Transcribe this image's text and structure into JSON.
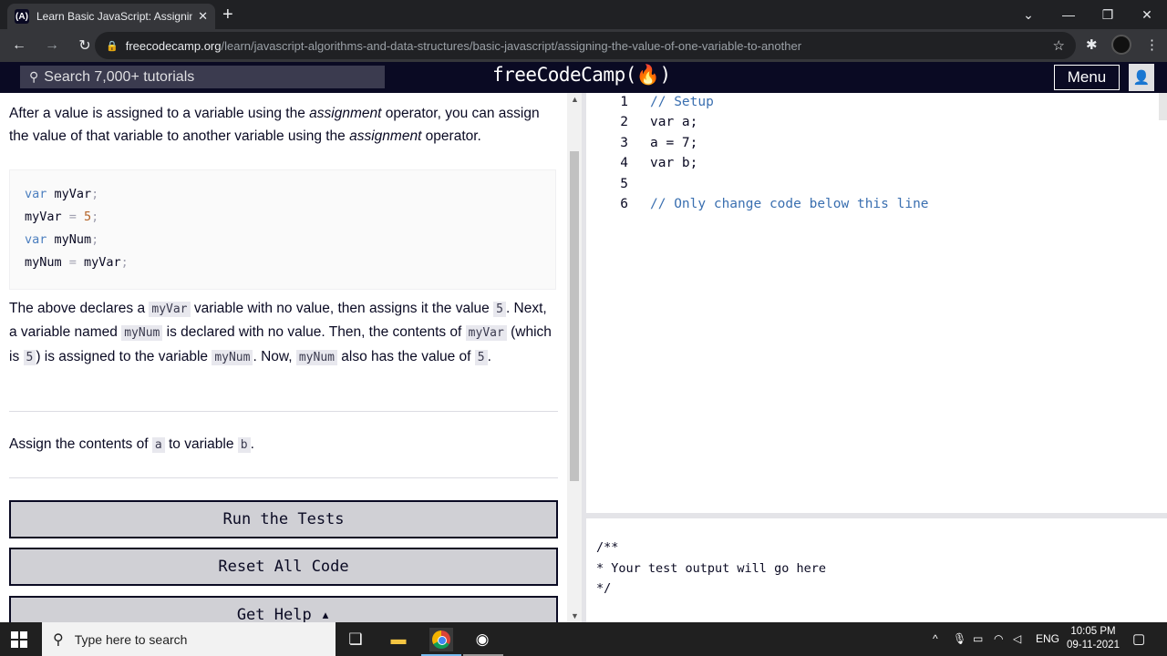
{
  "browser": {
    "tab_title": "Learn Basic JavaScript: Assigning",
    "tab_icon_text": "(A)",
    "url_host": "freecodecamp.org",
    "url_path": "/learn/javascript-algorithms-and-data-structures/basic-javascript/assigning-the-value-of-one-variable-to-another"
  },
  "fcc_nav": {
    "search_placeholder": "Search 7,000+ tutorials",
    "brand": "freeCodeCamp(🔥)",
    "menu_label": "Menu"
  },
  "lesson": {
    "intro_1": "After a value is assigned to a variable using the ",
    "intro_em1": "assignment",
    "intro_2": " operator, you can assign the value of that variable to another variable using the ",
    "intro_em2": "assignment",
    "intro_3": " operator.",
    "code_example": [
      {
        "a": "var",
        "b": " myVar",
        "c": ";",
        "d": ""
      },
      {
        "a": "",
        "b": "myVar",
        "c": " = ",
        "d": "5"
      },
      {
        "a": "var",
        "b": " myNum",
        "c": ";",
        "d": ""
      },
      {
        "a": "",
        "b": "myNum",
        "c": " = ",
        "d": "myVar"
      }
    ],
    "explain": {
      "t1": "The above declares a ",
      "c1": "myVar",
      "t2": " variable with no value, then assigns it the value ",
      "c2": "5",
      "t3": ". Next, a variable named ",
      "c3": "myNum",
      "t4": " is declared with no value. Then, the contents of ",
      "c4": "myVar",
      "t5": " (which is ",
      "c5": "5",
      "t6": ") is assigned to the variable ",
      "c6": "myNum",
      "t7": ". Now, ",
      "c7": "myNum",
      "t8": " also has the value of ",
      "c8": "5",
      "t9": "."
    },
    "task": {
      "t1": "Assign the contents of ",
      "c1": "a",
      "t2": " to variable ",
      "c2": "b",
      "t3": "."
    },
    "run_tests": "Run the Tests",
    "reset_code": "Reset All Code",
    "get_help": "Get Help ▴"
  },
  "editor": {
    "lines": [
      {
        "n": "1",
        "text": "// Setup"
      },
      {
        "n": "2",
        "text": "var a;"
      },
      {
        "n": "3",
        "text": "a = 7;"
      },
      {
        "n": "4",
        "text": "var b;"
      },
      {
        "n": "5",
        "text": ""
      },
      {
        "n": "6",
        "text": "// Only change code below this line"
      }
    ]
  },
  "output": {
    "l1": "/**",
    "l2": "* Your test output will go here",
    "l3": "*/"
  },
  "taskbar": {
    "search_placeholder": "Type here to search",
    "lang": "ENG",
    "time": "10:05 PM",
    "date": "09-11-2021"
  },
  "colors": {
    "fcc_dark": "#0a0a23",
    "button_gray": "#d0d0d5",
    "comment_blue": "#3a6fb0"
  }
}
